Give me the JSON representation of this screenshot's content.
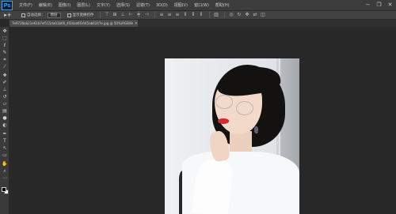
{
  "app": {
    "logo": "Ps"
  },
  "menu": {
    "items": [
      "文件(F)",
      "编辑(E)",
      "图像(I)",
      "图层(L)",
      "文字(Y)",
      "选择(S)",
      "滤镜(T)",
      "3D(D)",
      "视图(V)",
      "窗口(W)",
      "帮助(H)"
    ]
  },
  "window_controls": {
    "minimize": "−",
    "restore": "❐",
    "close": "✕"
  },
  "options": {
    "tool_glyph": "▸+",
    "auto_select_label": "自动选择：",
    "auto_select_value": "图层",
    "show_transform_label": "显示变换控件"
  },
  "document": {
    "tab_label": "7e9728ab21e61b7ef115da01b06_4f24aa6f3445ab6247e.jpg @ 50%(RGB/8#)",
    "close": "×"
  },
  "colors": {
    "menubar": "#3c3c3c",
    "workspace": "#282828",
    "ps_blue": "#31a8ff"
  }
}
